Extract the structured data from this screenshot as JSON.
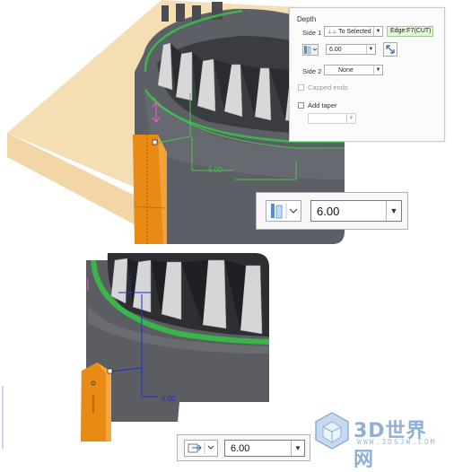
{
  "depth_panel": {
    "title": "Depth",
    "side1_label": "Side 1",
    "side1_option": "To Selected",
    "side1_reference": "Edge:F7(CUT)",
    "depth_value": "6.00",
    "side2_label": "Side 2",
    "side2_option": "None",
    "capped_ends_label": "Capped ends",
    "add_taper_label": "Add taper",
    "taper_value": ""
  },
  "top_view": {
    "dimension_label": "6.00",
    "depth_control": {
      "value": "6.00",
      "icon": "depth-to-selected-icon"
    }
  },
  "bottom_view": {
    "dimension_label": "6.00",
    "depth_control": {
      "value": "6.00",
      "icon": "depth-to-reference-icon"
    }
  },
  "watermark": {
    "logo_text": "3D世界网",
    "url_text": "WWW.3DSJW.COM"
  },
  "colors": {
    "part_gray": "#5c5f66",
    "edge_green": "#39b54a",
    "rib_orange": "#e98a14",
    "sketch_plane": "#f5ddb4",
    "dimension_green": "#4fc34f",
    "dimension_blue": "#1e2ec8"
  }
}
